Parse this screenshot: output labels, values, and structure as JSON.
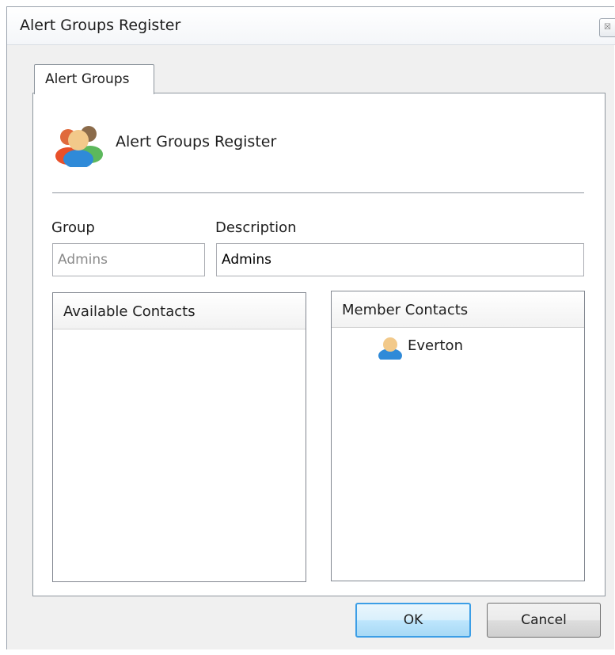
{
  "window": {
    "title": "Alert Groups Register",
    "close_glyph": "☒"
  },
  "tabs": [
    {
      "label": "Alert Groups",
      "active": true
    }
  ],
  "header": {
    "title": "Alert Groups Register",
    "icon": "users-group-icon"
  },
  "form": {
    "group_label": "Group",
    "group_value": "Admins",
    "description_label": "Description",
    "description_value": "Admins"
  },
  "available_contacts": {
    "header": "Available Contacts",
    "items": []
  },
  "member_contacts": {
    "header": "Member Contacts",
    "items": [
      {
        "name": "Everton",
        "icon": "user-icon"
      }
    ]
  },
  "buttons": {
    "ok_label": "OK",
    "cancel_label": "Cancel"
  },
  "colors": {
    "ok_border": "#3c9ee6",
    "window_bg": "#f0f0f0"
  }
}
